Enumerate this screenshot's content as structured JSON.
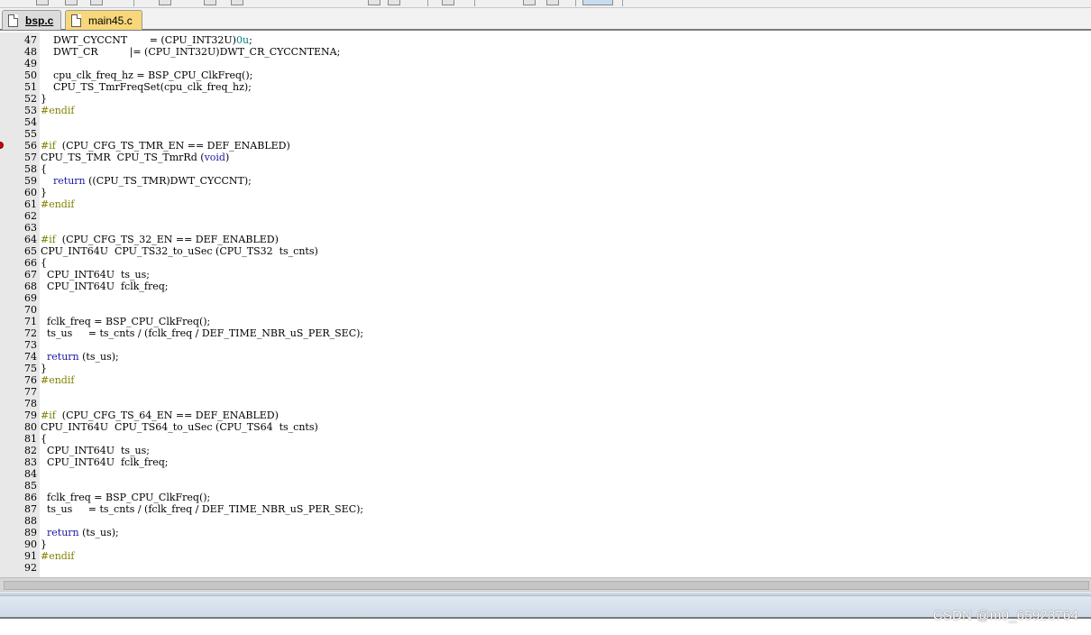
{
  "tabs": [
    {
      "label": "bsp.c",
      "active": true
    },
    {
      "label": "main45.c",
      "active": false
    }
  ],
  "code_lines": [
    {
      "num": "47",
      "segs": [
        [
          "",
          "    DWT_CYCCNT       = (CPU_INT32U)"
        ],
        [
          "num",
          "0u"
        ],
        [
          "",
          ";"
        ]
      ]
    },
    {
      "num": "48",
      "segs": [
        [
          "",
          "    DWT_CR          |= (CPU_INT32U)DWT_CR_CYCCNTENA;"
        ]
      ]
    },
    {
      "num": "49",
      "segs": []
    },
    {
      "num": "50",
      "segs": [
        [
          "",
          "    cpu_clk_freq_hz = BSP_CPU_ClkFreq();"
        ]
      ]
    },
    {
      "num": "51",
      "segs": [
        [
          "",
          "    CPU_TS_TmrFreqSet(cpu_clk_freq_hz);"
        ]
      ]
    },
    {
      "num": "52",
      "segs": [
        [
          "",
          "}"
        ]
      ]
    },
    {
      "num": "53",
      "segs": [
        [
          "pp",
          "#endif"
        ]
      ]
    },
    {
      "num": "54",
      "segs": []
    },
    {
      "num": "55",
      "segs": []
    },
    {
      "num": "56",
      "segs": [
        [
          "pp",
          "#if"
        ],
        [
          "",
          "  (CPU_CFG_TS_TMR_EN == DEF_ENABLED)"
        ]
      ],
      "breakpoint": true
    },
    {
      "num": "57",
      "segs": [
        [
          "",
          "CPU_TS_TMR  CPU_TS_TmrRd ("
        ],
        [
          "kw",
          "void"
        ],
        [
          "",
          ")"
        ]
      ]
    },
    {
      "num": "58",
      "segs": [
        [
          "",
          "{"
        ]
      ]
    },
    {
      "num": "59",
      "segs": [
        [
          "",
          "    "
        ],
        [
          "kw",
          "return"
        ],
        [
          "",
          " ((CPU_TS_TMR)DWT_CYCCNT);"
        ]
      ]
    },
    {
      "num": "60",
      "segs": [
        [
          "",
          "}"
        ]
      ]
    },
    {
      "num": "61",
      "segs": [
        [
          "pp",
          "#endif"
        ]
      ]
    },
    {
      "num": "62",
      "segs": []
    },
    {
      "num": "63",
      "segs": []
    },
    {
      "num": "64",
      "segs": [
        [
          "pp",
          "#if"
        ],
        [
          "",
          "  (CPU_CFG_TS_32_EN == DEF_ENABLED)"
        ]
      ]
    },
    {
      "num": "65",
      "segs": [
        [
          "",
          "CPU_INT64U  CPU_TS32_to_uSec (CPU_TS32  ts_cnts)"
        ]
      ]
    },
    {
      "num": "66",
      "segs": [
        [
          "",
          "{"
        ]
      ]
    },
    {
      "num": "67",
      "segs": [
        [
          "",
          "  CPU_INT64U  ts_us;"
        ]
      ]
    },
    {
      "num": "68",
      "segs": [
        [
          "",
          "  CPU_INT64U  fclk_freq;"
        ]
      ]
    },
    {
      "num": "69",
      "segs": []
    },
    {
      "num": "70",
      "segs": []
    },
    {
      "num": "71",
      "segs": [
        [
          "",
          "  fclk_freq = BSP_CPU_ClkFreq();"
        ]
      ]
    },
    {
      "num": "72",
      "segs": [
        [
          "",
          "  ts_us     = ts_cnts / (fclk_freq / DEF_TIME_NBR_uS_PER_SEC);"
        ]
      ]
    },
    {
      "num": "73",
      "segs": []
    },
    {
      "num": "74",
      "segs": [
        [
          "",
          "  "
        ],
        [
          "kw",
          "return"
        ],
        [
          "",
          " (ts_us);"
        ]
      ]
    },
    {
      "num": "75",
      "segs": [
        [
          "",
          "}"
        ]
      ]
    },
    {
      "num": "76",
      "segs": [
        [
          "pp",
          "#endif"
        ]
      ]
    },
    {
      "num": "77",
      "segs": []
    },
    {
      "num": "78",
      "segs": []
    },
    {
      "num": "79",
      "segs": [
        [
          "pp",
          "#if"
        ],
        [
          "",
          "  (CPU_CFG_TS_64_EN == DEF_ENABLED)"
        ]
      ]
    },
    {
      "num": "80",
      "segs": [
        [
          "",
          "CPU_INT64U  CPU_TS64_to_uSec (CPU_TS64  ts_cnts)"
        ]
      ]
    },
    {
      "num": "81",
      "segs": [
        [
          "",
          "{"
        ]
      ]
    },
    {
      "num": "82",
      "segs": [
        [
          "",
          "  CPU_INT64U  ts_us;"
        ]
      ]
    },
    {
      "num": "83",
      "segs": [
        [
          "",
          "  CPU_INT64U  fclk_freq;"
        ]
      ]
    },
    {
      "num": "84",
      "segs": []
    },
    {
      "num": "85",
      "segs": []
    },
    {
      "num": "86",
      "segs": [
        [
          "",
          "  fclk_freq = BSP_CPU_ClkFreq();"
        ]
      ]
    },
    {
      "num": "87",
      "segs": [
        [
          "",
          "  ts_us     = ts_cnts / (fclk_freq / DEF_TIME_NBR_uS_PER_SEC);"
        ]
      ]
    },
    {
      "num": "88",
      "segs": []
    },
    {
      "num": "89",
      "segs": [
        [
          "",
          "  "
        ],
        [
          "kw",
          "return"
        ],
        [
          "",
          " (ts_us);"
        ]
      ]
    },
    {
      "num": "90",
      "segs": [
        [
          "",
          "}"
        ]
      ]
    },
    {
      "num": "91",
      "segs": [
        [
          "pp",
          "#endif"
        ]
      ]
    },
    {
      "num": "92",
      "segs": []
    }
  ],
  "watermark": "CSDN @m0_65923764",
  "colors": {
    "keyword": "#1a1aa6",
    "preprocessor": "#808000",
    "number": "#008080",
    "gutter": "#e8e8e8",
    "active_tab": "#dcdcdc",
    "inactive_tab": "#f7d77a",
    "breakpoint": "#d40000"
  },
  "icons": {
    "tab_file": "file-icon",
    "breakpoint": "breakpoint-icon"
  }
}
